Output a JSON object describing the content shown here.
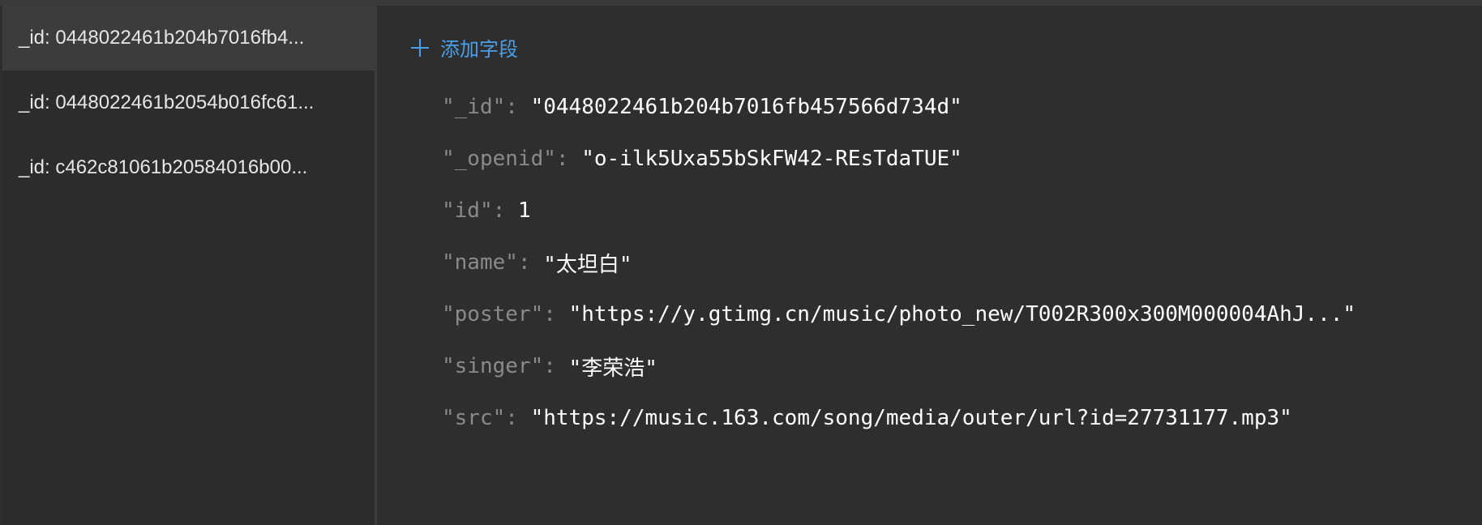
{
  "sidebar": {
    "records": [
      {
        "label": "_id: 0448022461b204b7016fb4...",
        "selected": true
      },
      {
        "label": "_id: 0448022461b2054b016fc61...",
        "selected": false
      },
      {
        "label": "_id: c462c81061b20584016b00...",
        "selected": false
      }
    ]
  },
  "main": {
    "add_field_label": "添加字段",
    "fields": [
      {
        "key": "\"_id\"",
        "value": "\"0448022461b204b7016fb457566d734d\""
      },
      {
        "key": "\"_openid\"",
        "value": "\"o-ilk5Uxa55bSkFW42-REsTdaTUE\""
      },
      {
        "key": "\"id\"",
        "value": "1"
      },
      {
        "key": "\"name\"",
        "value": "\"太坦白\""
      },
      {
        "key": "\"poster\"",
        "value": "\"https://y.gtimg.cn/music/photo_new/T002R300x300M000004AhJ...\""
      },
      {
        "key": "\"singer\"",
        "value": "\"李荣浩\""
      },
      {
        "key": "\"src\"",
        "value": "\"https://music.163.com/song/media/outer/url?id=27731177.mp3\""
      }
    ]
  },
  "icons": {
    "add": "plus-icon"
  },
  "colors": {
    "background": "#2e2e2e",
    "sidebar_selected": "#3c3c3c",
    "accent": "#4a9fe8",
    "key_text": "#8a8a8a",
    "value_text": "#ffffff"
  }
}
